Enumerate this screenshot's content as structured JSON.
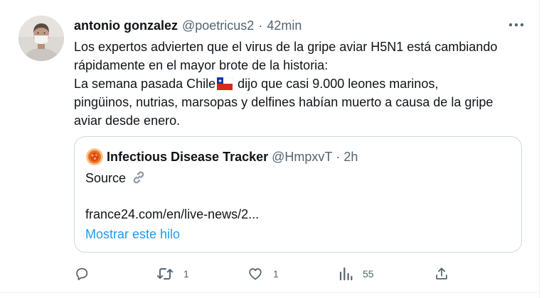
{
  "tweet": {
    "author": {
      "display_name": "antonio gonzalez",
      "handle": "@poetricus2",
      "time": "42min",
      "separator": "·"
    },
    "text": {
      "line1": "Los expertos advierten que el virus de la gripe aviar H5N1 está cambiando",
      "line2": "rápidamente en el mayor brote de la historia:",
      "line3_a": "La semana pasada Chile",
      "line3_b": "dijo que casi 9.000 leones marinos,",
      "line4": "pingüinos, nutrias, marsopas y delfines habían muerto a causa de la gripe",
      "line5": "aviar desde enero."
    },
    "icons": {
      "more": "more-horizontal-icon",
      "flag": "chile-flag-icon"
    }
  },
  "quote": {
    "display_name": "Infectious Disease Tracker",
    "handle": "@HmpxvT",
    "separator": "·",
    "time": "2h",
    "body": "Source",
    "link_icon": "link-icon",
    "link_text": "france24.com/en/live-news/2...",
    "show_thread": "Mostrar este hilo"
  },
  "actions": {
    "reply": {
      "icon": "reply-icon",
      "count": ""
    },
    "retweet": {
      "icon": "retweet-icon",
      "count": "1"
    },
    "like": {
      "icon": "like-icon",
      "count": "1"
    },
    "views": {
      "icon": "views-icon",
      "count": "55"
    },
    "share": {
      "icon": "share-icon",
      "count": ""
    }
  },
  "colors": {
    "text": "#0f1419",
    "muted": "#536471",
    "accent": "#1d9bf0",
    "border": "#cfd9de"
  }
}
